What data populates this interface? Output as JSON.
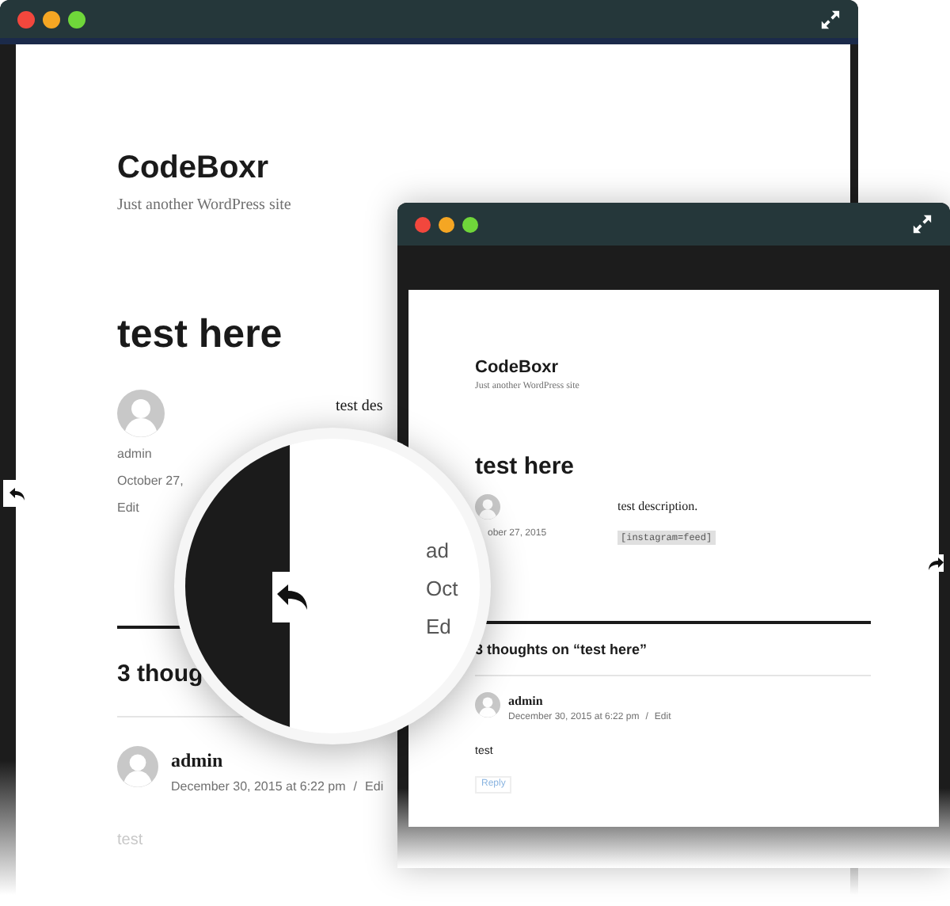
{
  "back_window": {
    "site_title": "CodeBoxr",
    "tagline": "Just another WordPress site",
    "post_title": "test here",
    "excerpt": "test des",
    "author": "admin",
    "date": "October 27,",
    "edit": "Edit",
    "comments_heading": "3 thoug",
    "comment": {
      "author": "admin",
      "date": "December 30, 2015 at 6:22 pm",
      "separator": "/",
      "edit": "Edi",
      "text": "test"
    }
  },
  "front_window": {
    "site_title": "CodeBoxr",
    "tagline": "Just another WordPress site",
    "post_title": "test here",
    "excerpt": "test description.",
    "shortcode": "[instagram=feed]",
    "date": "ober 27, 2015",
    "comments_heading": "3 thoughts on “test here”",
    "comment": {
      "author": "admin",
      "date": "December 30, 2015 at 6:22 pm",
      "separator": "/",
      "edit": "Edit",
      "text": "test",
      "reply": "Reply"
    }
  },
  "magnifier": {
    "texts": [
      "ad",
      "Oct",
      "Ed"
    ]
  }
}
